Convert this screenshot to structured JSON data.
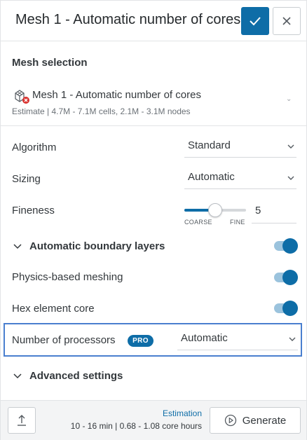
{
  "header": {
    "title": "Mesh 1 - Automatic number of cores",
    "confirm_icon": "check-icon",
    "close_icon": "close-icon"
  },
  "mesh_selection": {
    "label": "Mesh selection",
    "icon": "mesh-error-icon",
    "name": "Mesh 1 - Automatic number of cores",
    "estimate": "Estimate | 4.7M - 7.1M cells, 2.1M - 3.1M nodes",
    "chevron": "⌄"
  },
  "settings": {
    "algorithm": {
      "label": "Algorithm",
      "value": "Standard"
    },
    "sizing": {
      "label": "Sizing",
      "value": "Automatic"
    },
    "fineness": {
      "label": "Fineness",
      "value": "5",
      "level": 0.5,
      "min_label": "COARSE",
      "max_label": "FINE"
    },
    "boundary_layers": {
      "label": "Automatic boundary layers",
      "enabled": true
    },
    "physics_meshing": {
      "label": "Physics-based meshing",
      "enabled": true
    },
    "hex_core": {
      "label": "Hex element core",
      "enabled": true
    },
    "processors": {
      "label": "Number of processors",
      "badge": "PRO",
      "value": "Automatic"
    },
    "advanced": {
      "label": "Advanced settings"
    }
  },
  "footer": {
    "export_icon": "upload-icon",
    "estimation_label": "Estimation",
    "estimation_value": "10 - 16 min | 0.68 - 1.08 core hours",
    "generate_label": "Generate",
    "generate_icon": "play-icon"
  },
  "colors": {
    "accent": "#0e6da7",
    "highlight_border": "#4a7fcf",
    "error": "#d9322f"
  }
}
